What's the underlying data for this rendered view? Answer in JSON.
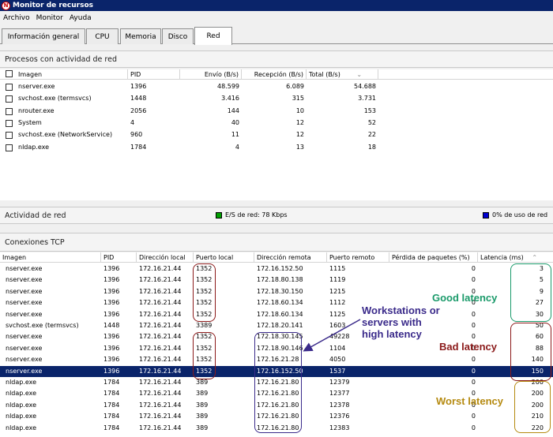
{
  "window": {
    "title": "Monitor de recursos"
  },
  "menu": [
    "Archivo",
    "Monitor",
    "Ayuda"
  ],
  "tabs": [
    {
      "label": "Información general",
      "active": false
    },
    {
      "label": "CPU",
      "active": false
    },
    {
      "label": "Memoria",
      "active": false
    },
    {
      "label": "Disco",
      "active": false
    },
    {
      "label": "Red",
      "active": true
    }
  ],
  "processes": {
    "title": "Procesos con actividad de red",
    "columns": [
      "Imagen",
      "PID",
      "Envío (B/s)",
      "Recepción (B/s)",
      "Total (B/s)"
    ],
    "rows": [
      [
        "nserver.exe",
        "1396",
        "48.599",
        "6.089",
        "54.688"
      ],
      [
        "svchost.exe (termsvcs)",
        "1448",
        "3.416",
        "315",
        "3.731"
      ],
      [
        "nrouter.exe",
        "2056",
        "144",
        "10",
        "153"
      ],
      [
        "System",
        "4",
        "40",
        "12",
        "52"
      ],
      [
        "svchost.exe (NetworkService)",
        "960",
        "11",
        "12",
        "22"
      ],
      [
        "nldap.exe",
        "1784",
        "4",
        "13",
        "18"
      ]
    ]
  },
  "activity": {
    "title": "Actividad de red",
    "io_label": "E/S de red: 78 Kbps",
    "usage_label": "0% de uso de red",
    "io_color": "#00a000",
    "usage_color": "#0000d0"
  },
  "tcp": {
    "title": "Conexiones TCP",
    "columns": [
      "Imagen",
      "PID",
      "Dirección local",
      "Puerto local",
      "Dirección remota",
      "Puerto remoto",
      "Pérdida de paquetes (%)",
      "Latencia (ms)"
    ],
    "selected_row": 9,
    "rows": [
      [
        "nserver.exe",
        "1396",
        "172.16.21.44",
        "1352",
        "172.16.152.50",
        "1115",
        "0",
        "3"
      ],
      [
        "nserver.exe",
        "1396",
        "172.16.21.44",
        "1352",
        "172.18.80.138",
        "1119",
        "0",
        "5"
      ],
      [
        "nserver.exe",
        "1396",
        "172.16.21.44",
        "1352",
        "172.18.30.150",
        "1215",
        "0",
        "9"
      ],
      [
        "nserver.exe",
        "1396",
        "172.16.21.44",
        "1352",
        "172.18.60.134",
        "1112",
        "0",
        "27"
      ],
      [
        "nserver.exe",
        "1396",
        "172.16.21.44",
        "1352",
        "172.18.60.134",
        "1125",
        "0",
        "30"
      ],
      [
        "svchost.exe (termsvcs)",
        "1448",
        "172.16.21.44",
        "3389",
        "172.18.20.141",
        "1603",
        "0",
        "50"
      ],
      [
        "nserver.exe",
        "1396",
        "172.16.21.44",
        "1352",
        "172.18.30.145",
        "49228",
        "0",
        "60"
      ],
      [
        "nserver.exe",
        "1396",
        "172.16.21.44",
        "1352",
        "172.18.90.146",
        "1104",
        "0",
        "88"
      ],
      [
        "nserver.exe",
        "1396",
        "172.16.21.44",
        "1352",
        "172.16.21.28",
        "4050",
        "0",
        "140"
      ],
      [
        "nserver.exe",
        "1396",
        "172.16.21.44",
        "1352",
        "172.16.152.50",
        "1537",
        "0",
        "150"
      ],
      [
        "nldap.exe",
        "1784",
        "172.16.21.44",
        "389",
        "172.16.21.80",
        "12379",
        "0",
        "200"
      ],
      [
        "nldap.exe",
        "1784",
        "172.16.21.44",
        "389",
        "172.16.21.80",
        "12377",
        "0",
        "200"
      ],
      [
        "nldap.exe",
        "1784",
        "172.16.21.44",
        "389",
        "172.16.21.80",
        "12378",
        "0",
        "200"
      ],
      [
        "nldap.exe",
        "1784",
        "172.16.21.44",
        "389",
        "172.16.21.80",
        "12376",
        "0",
        "210"
      ],
      [
        "nldap.exe",
        "1784",
        "172.16.21.44",
        "389",
        "172.16.21.80",
        "12383",
        "0",
        "220"
      ]
    ]
  },
  "annotations": {
    "workstations": "Workstations or servers with high latency",
    "good": "Good latency",
    "bad": "Bad latency",
    "worst": "Worst latency",
    "good_color": "#1a9a6a",
    "bad_color": "#8b1a1a",
    "worst_color": "#b58a10",
    "remote_color": "#3a2a8a"
  }
}
